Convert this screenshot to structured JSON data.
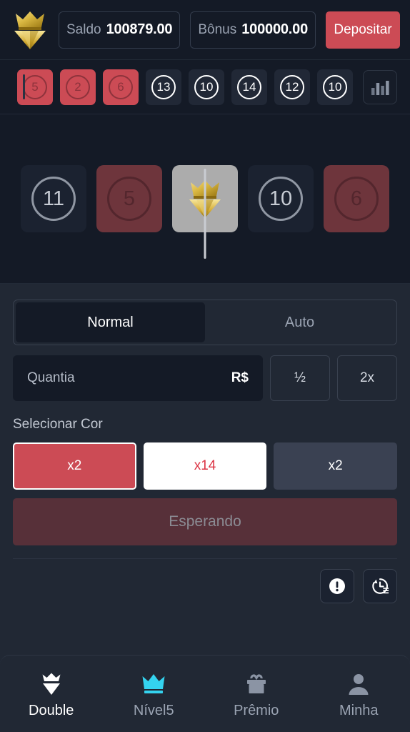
{
  "header": {
    "logo_icon": "crown-diamond-logo",
    "balance": {
      "label": "Saldo",
      "value": "100879.00"
    },
    "bonus": {
      "label": "Bônus",
      "value": "100000.00"
    },
    "deposit_label": "Depositar"
  },
  "history": {
    "chart_icon": "bar-chart-icon",
    "tiles": [
      {
        "value": "5",
        "color": "red"
      },
      {
        "value": "2",
        "color": "red"
      },
      {
        "value": "6",
        "color": "red"
      },
      {
        "value": "13",
        "color": "dark"
      },
      {
        "value": "10",
        "color": "dark"
      },
      {
        "value": "14",
        "color": "dark"
      },
      {
        "value": "12",
        "color": "dark"
      },
      {
        "value": "10",
        "color": "dark"
      }
    ]
  },
  "carousel": {
    "needle": "result-marker",
    "tiles": [
      {
        "value": "11",
        "color": "dark"
      },
      {
        "value": "5",
        "color": "red"
      },
      {
        "value": "",
        "color": "white",
        "icon": "crown-diamond-logo"
      },
      {
        "value": "10",
        "color": "dark"
      },
      {
        "value": "6",
        "color": "red"
      }
    ]
  },
  "controls": {
    "modes": [
      {
        "label": "Normal",
        "active": true
      },
      {
        "label": "Auto",
        "active": false
      }
    ],
    "amount": {
      "placeholder": "Quantia",
      "value": "",
      "currency": "R$"
    },
    "quick_half": "½",
    "quick_double": "2x",
    "select_color_label": "Selecionar Cor",
    "color_options": [
      {
        "multiplier": "x2",
        "color": "red",
        "hex": "#cc4b55",
        "selected": true
      },
      {
        "multiplier": "x14",
        "color": "white",
        "hex": "#ffffff",
        "selected": false
      },
      {
        "multiplier": "x2",
        "color": "black",
        "hex": "#3a4152",
        "selected": false
      }
    ],
    "bet_button_label": "Esperando",
    "tools": [
      {
        "icon": "info-alert-icon"
      },
      {
        "icon": "history-clock-icon"
      }
    ]
  },
  "bottom_nav": [
    {
      "label": "Double",
      "icon": "crown-diamond-icon",
      "active": true
    },
    {
      "label": "Nível5",
      "icon": "crown-icon",
      "active": false
    },
    {
      "label": "Prêmio",
      "icon": "gift-icon",
      "active": false
    },
    {
      "label": "Minha",
      "icon": "person-icon",
      "active": false
    }
  ],
  "colors": {
    "accent_red": "#cc4b55",
    "page_bg": "#212834",
    "panel_bg": "#141a26",
    "cyan": "#34d3ef",
    "gold": "#d8b13c"
  }
}
